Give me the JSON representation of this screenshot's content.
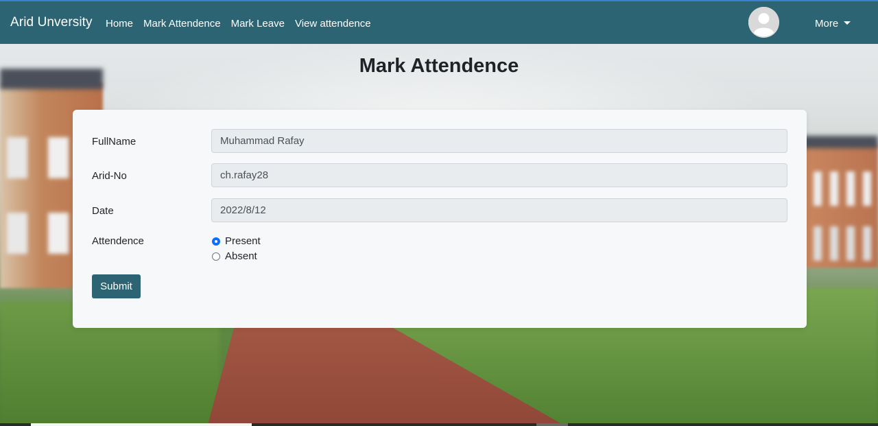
{
  "navbar": {
    "brand": "Arid Unversity",
    "links": [
      "Home",
      "Mark Attendence",
      "Mark Leave",
      "View attendence"
    ],
    "more_label": "More",
    "avatar_icon": "user-avatar-icon",
    "bg_color": "#2c6473"
  },
  "page": {
    "title": "Mark Attendence"
  },
  "form": {
    "fullname_label": "FullName",
    "fullname_value": "Muhammad Rafay",
    "aridno_label": "Arid-No",
    "aridno_value": "ch.rafay28",
    "date_label": "Date",
    "date_value": "2022/8/12",
    "attendence_label": "Attendence",
    "options": [
      {
        "label": "Present",
        "checked": true
      },
      {
        "label": "Absent",
        "checked": false
      }
    ],
    "submit_label": "Submit"
  },
  "colors": {
    "accent": "#2c6473",
    "radio_checked": "#0d6efd"
  }
}
